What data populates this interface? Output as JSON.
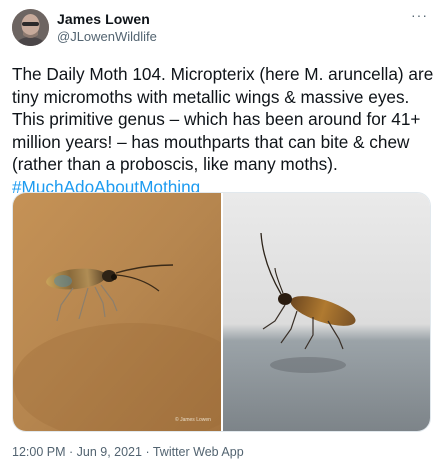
{
  "author": {
    "name": "James Lowen",
    "handle": "@JLowenWildlife"
  },
  "menu_icon": "more-dots-icon",
  "tweet": {
    "text": "The Daily Moth 104. Micropterix (here M. aruncella) are tiny micromoths with metallic wings & massive eyes. This primitive genus – which has been around for 41+ million years! – has mouthparts that can bite & chew (rather than a proboscis, like many moths).",
    "hashtag": "#MuchAdoAboutMothing"
  },
  "media": {
    "left_photo_credit": "© James Lowen"
  },
  "meta": {
    "time": "12:00 PM",
    "date": "Jun 9, 2021",
    "source": "Twitter Web App",
    "separator": " · "
  },
  "colors": {
    "link": "#1d9bf0",
    "secondary_text": "#536471"
  }
}
